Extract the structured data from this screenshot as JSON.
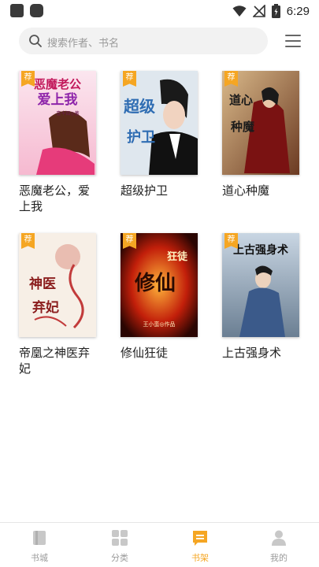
{
  "status_bar": {
    "time": "6:29"
  },
  "search": {
    "placeholder": "搜索作者、书名"
  },
  "books": [
    {
      "title": "恶魔老公，爱上我",
      "badge": "荐"
    },
    {
      "title": "超级护卫",
      "badge": "荐"
    },
    {
      "title": "道心种魔",
      "badge": "荐"
    },
    {
      "title": "帝凰之神医弃妃",
      "badge": "荐"
    },
    {
      "title": "修仙狂徒",
      "badge": "荐"
    },
    {
      "title": "上古强身术",
      "badge": "荐"
    }
  ],
  "covers": {
    "book1": {
      "title_art": "恶魔老公",
      "sub_art": "爱上我",
      "author": "喜十四◎著"
    },
    "book2": {
      "title_art": "超级",
      "sub_art": "护卫"
    },
    "book3": {
      "title_art": "道心",
      "sub_art": "种魔"
    },
    "book4": {
      "title_art": "神医",
      "sub_art": "弃妃"
    },
    "book5": {
      "title_art": "修仙",
      "sub_art": "狂徒",
      "author": "王小蛮◎作品"
    },
    "book6": {
      "title_art": "上古强身术"
    }
  },
  "bottom_nav": [
    {
      "label": "书城",
      "icon": "book-icon",
      "active": false
    },
    {
      "label": "分类",
      "icon": "grid-icon",
      "active": false
    },
    {
      "label": "书架",
      "icon": "bookshelf-icon",
      "active": true
    },
    {
      "label": "我的",
      "icon": "person-icon",
      "active": false
    }
  ],
  "colors": {
    "accent": "#f5a623",
    "inactive": "#9a9a9a"
  }
}
